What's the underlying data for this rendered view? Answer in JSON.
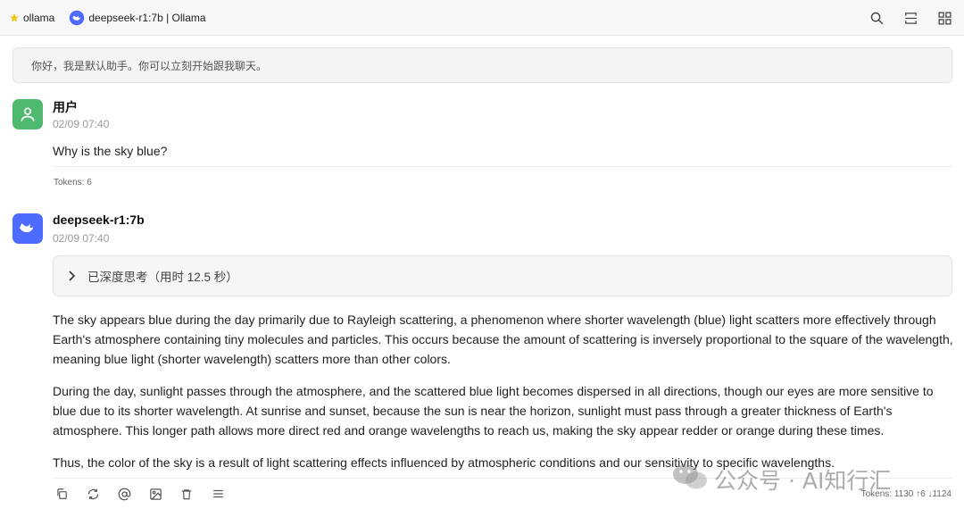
{
  "tabs": [
    {
      "label": "ollama",
      "icon": "star-icon"
    },
    {
      "label": "deepseek-r1:7b | Ollama",
      "icon": "deepseek-logo-icon"
    }
  ],
  "toolbar": {
    "icons": [
      "search-icon",
      "expand-icon",
      "grid-icon"
    ]
  },
  "system_message": "你好，我是默认助手。你可以立刻开始跟我聊天。",
  "user_msg": {
    "name": "用户",
    "time": "02/09 07:40",
    "text": "Why is the sky blue?",
    "tokens": "Tokens: 6"
  },
  "bot_msg": {
    "name": "deepseek-r1:7b",
    "time": "02/09 07:40",
    "thinking_label": "已深度思考（用时 12.5 秒）",
    "paragraphs": [
      "The sky appears blue during the day primarily due to Rayleigh scattering, a phenomenon where shorter wavelength (blue) light scatters more effectively through Earth's atmosphere containing tiny molecules and particles. This occurs because the amount of scattering is inversely proportional to the square of the wavelength, meaning blue light (shorter wavelength) scatters more than other colors.",
      "During the day, sunlight passes through the atmosphere, and the scattered blue light becomes dispersed in all directions, though our eyes are more sensitive to blue due to its shorter wavelength. At sunrise and sunset, because the sun is near the horizon, sunlight must pass through a greater thickness of Earth's atmosphere. This longer path allows more direct red and orange wavelengths to reach us, making the sky appear redder or orange during these times.",
      "Thus, the color of the sky is a result of light scattering effects influenced by atmospheric conditions and our sensitivity to specific wavelengths."
    ],
    "tokens": "Tokens: 1130 ↑6 ↓1124"
  },
  "action_icons": [
    "copy-icon",
    "regenerate-icon",
    "mention-icon",
    "image-icon",
    "delete-icon",
    "menu-icon"
  ],
  "watermark": "公众号 · AI知行汇",
  "colors": {
    "user_avatar": "#4fb96f",
    "bot_avatar": "#4d6bfe"
  }
}
